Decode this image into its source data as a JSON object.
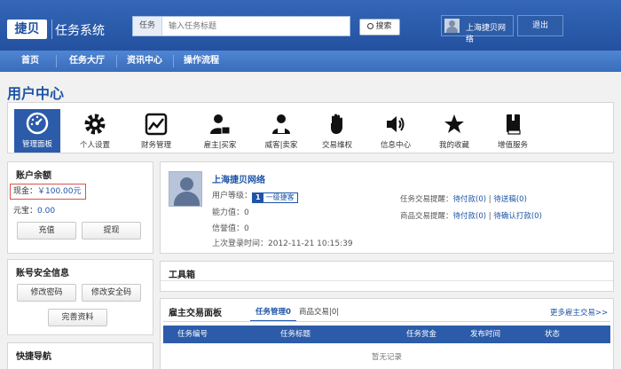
{
  "header": {
    "logo": "捷贝",
    "subtitle": "任务系统",
    "search_label": "任务",
    "search_placeholder": "输入任务标题",
    "search_button": "搜索",
    "user_name": "上海捷贝网络",
    "logout": "退出"
  },
  "nav": {
    "items": [
      "首页",
      "任务大厅",
      "资讯中心",
      "操作流程"
    ]
  },
  "page_title": "用户中心",
  "iconbar": {
    "items": [
      {
        "label": "管理面板",
        "icon": "dashboard-icon"
      },
      {
        "label": "个人设置",
        "icon": "gear-icon"
      },
      {
        "label": "财务管理",
        "icon": "chart-icon"
      },
      {
        "label": "雇主|买家",
        "icon": "employer-icon"
      },
      {
        "label": "威客|卖家",
        "icon": "seller-icon"
      },
      {
        "label": "交易维权",
        "icon": "hand-icon"
      },
      {
        "label": "信息中心",
        "icon": "speaker-icon"
      },
      {
        "label": "我的收藏",
        "icon": "star-icon"
      },
      {
        "label": "增值服务",
        "icon": "book-icon"
      }
    ]
  },
  "balance": {
    "title": "账户余额",
    "cash_label": "现金：",
    "cash_value": "￥100.00元",
    "gold_label": "元宝：",
    "gold_value": "0.00",
    "recharge": "充值",
    "withdraw": "提现"
  },
  "security": {
    "title": "账号安全信息",
    "change_password": "修改密码",
    "change_security_code": "修改安全码",
    "complete_profile": "完善资料"
  },
  "quicknav": {
    "title": "快捷导航"
  },
  "profile": {
    "name": "上海捷贝网络",
    "level_label": "用户等级：",
    "level_num": "1",
    "level_text": "一级捷客",
    "ability": "能力值：0",
    "credit": "信誉值：0",
    "last_login": "上次登录时间：2012-11-21 10:15:39",
    "task_trade_label": "任务交易提醒：",
    "task_pay": "待付款(0)",
    "task_submit": "待送稿(0)",
    "goods_trade_label": "商品交易提醒：",
    "goods_pay": "待付款(0)",
    "goods_confirm": "待确认打款(0)"
  },
  "toolbox": {
    "title": "工具箱"
  },
  "employer": {
    "title": "雇主交易面板",
    "tab_task": "任务管理0",
    "tab_goods": "商品交易|0|",
    "more": "更多雇主交易>>",
    "columns": [
      "任务编号",
      "任务标题",
      "任务赏金",
      "发布时间",
      "状态"
    ],
    "empty": "暂无记录"
  },
  "colors": {
    "header_blue": "#23519f",
    "nav_blue": "#3a6cbc",
    "accent": "#1e55a6",
    "alert_red": "#d9534f"
  }
}
